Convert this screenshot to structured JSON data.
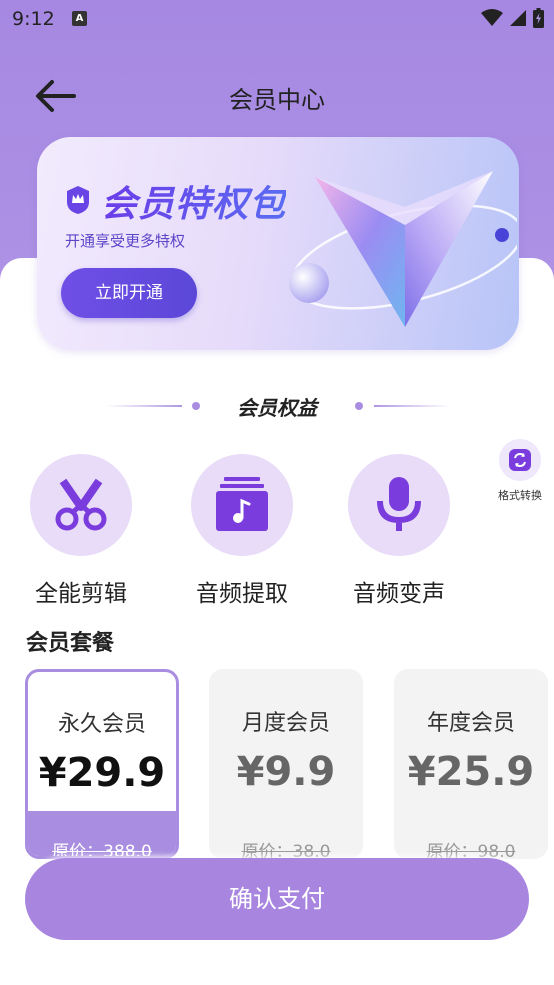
{
  "status_bar": {
    "time": "9:12",
    "icons": [
      "notification-a-icon",
      "wifi-icon",
      "signal-icon",
      "battery-charging-icon"
    ]
  },
  "header": {
    "title": "会员中心",
    "back_icon": "arrow-left-icon"
  },
  "banner": {
    "title": "会员特权包",
    "subtitle": "开通享受更多特权",
    "button_label": "立即开通",
    "icons": [
      "crown-shield-icon",
      "v-logo-graphic"
    ]
  },
  "benefits": {
    "heading": "会员权益",
    "features": [
      {
        "label": "全能剪辑",
        "icon": "scissors-icon"
      },
      {
        "label": "音频提取",
        "icon": "music-album-icon"
      },
      {
        "label": "音频变声",
        "icon": "microphone-icon"
      }
    ],
    "extra": {
      "label": "格式转换",
      "icon": "convert-icon"
    }
  },
  "plans": {
    "title": "会员套餐",
    "items": [
      {
        "name": "永久会员",
        "price": "¥29.9",
        "original": "原价：388.0",
        "selected": true
      },
      {
        "name": "月度会员",
        "price": "¥9.9",
        "original": "原价：38.0",
        "selected": false
      },
      {
        "name": "年度会员",
        "price": "¥25.9",
        "original": "原价：98.0",
        "selected": false
      }
    ]
  },
  "confirm_button": "确认支付",
  "colors": {
    "accent": "#a98de0",
    "header_bg": "#a688e2",
    "button_primary": "#5b47d8"
  }
}
